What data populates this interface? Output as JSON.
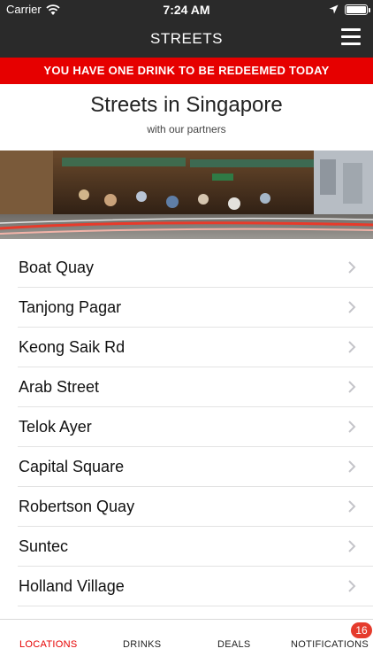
{
  "status_bar": {
    "carrier": "Carrier",
    "time": "7:24 AM"
  },
  "nav": {
    "title": "STREETS"
  },
  "banner": {
    "text": "YOU HAVE ONE DRINK TO BE REDEEMED TODAY"
  },
  "header": {
    "title": "Streets in Singapore",
    "subtitle": "with our partners"
  },
  "streets": [
    {
      "label": "Boat Quay"
    },
    {
      "label": "Tanjong Pagar"
    },
    {
      "label": "Keong Saik Rd"
    },
    {
      "label": "Arab Street"
    },
    {
      "label": "Telok Ayer"
    },
    {
      "label": "Capital Square"
    },
    {
      "label": "Robertson Quay"
    },
    {
      "label": "Suntec"
    },
    {
      "label": "Holland Village"
    }
  ],
  "tabs": [
    {
      "label": "LOCATIONS",
      "active": true
    },
    {
      "label": "DRINKS",
      "active": false
    },
    {
      "label": "DEALS",
      "active": false
    },
    {
      "label": "NOTIFICATIONS",
      "active": false
    }
  ],
  "notifications_badge": "16",
  "colors": {
    "accent": "#e60000",
    "bar": "#2a2a2a",
    "badge": "#e53b2c"
  },
  "icons": {
    "wifi": "wifi-icon",
    "location": "location-arrow-icon",
    "battery": "battery-icon",
    "menu": "hamburger-menu-icon",
    "chevron": "chevron-right-icon"
  }
}
